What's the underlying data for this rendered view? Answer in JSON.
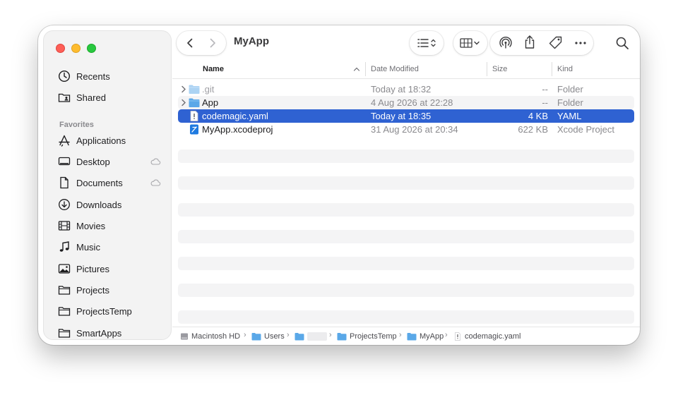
{
  "window": {
    "title": "MyApp"
  },
  "colors": {
    "selection": "#2f62d2",
    "folder": "#5aa8e8",
    "traffic_red": "#fe5f57",
    "traffic_yellow": "#febc2e",
    "traffic_green": "#28c840"
  },
  "sidebar": {
    "items_top": [
      {
        "label": "Recents",
        "icon": "clock-icon"
      },
      {
        "label": "Shared",
        "icon": "shared-folder-icon"
      }
    ],
    "favorites_heading": "Favorites",
    "favorites": [
      {
        "label": "Applications",
        "icon": "applications-icon"
      },
      {
        "label": "Desktop",
        "icon": "desktop-icon",
        "icloud": true
      },
      {
        "label": "Documents",
        "icon": "document-icon",
        "icloud": true
      },
      {
        "label": "Downloads",
        "icon": "download-icon"
      },
      {
        "label": "Movies",
        "icon": "film-icon"
      },
      {
        "label": "Music",
        "icon": "music-note-icon"
      },
      {
        "label": "Pictures",
        "icon": "photo-icon"
      },
      {
        "label": "Projects",
        "icon": "folder-icon"
      },
      {
        "label": "ProjectsTemp",
        "icon": "folder-icon"
      },
      {
        "label": "SmartApps",
        "icon": "folder-icon"
      }
    ]
  },
  "columns": {
    "name": "Name",
    "date": "Date Modified",
    "size": "Size",
    "kind": "Kind"
  },
  "files": [
    {
      "name": ".git",
      "date": "Today at 18:32",
      "size": "--",
      "kind": "Folder",
      "icon": "folder-icon",
      "expandable": true,
      "hidden": true
    },
    {
      "name": "App",
      "date": "4 Aug 2026 at 22:28",
      "size": "--",
      "kind": "Folder",
      "icon": "folder-icon",
      "expandable": true
    },
    {
      "name": "codemagic.yaml",
      "date": "Today at 18:35",
      "size": "4 KB",
      "kind": "YAML",
      "icon": "yaml-file-icon",
      "selected": true
    },
    {
      "name": "MyApp.xcodeproj",
      "date": "31 Aug 2026 at 20:34",
      "size": "622 KB",
      "kind": "Xcode Project",
      "icon": "xcodeproj-icon"
    }
  ],
  "pathbar": [
    "Macintosh HD",
    "Users",
    "",
    "ProjectsTemp",
    "MyApp",
    "codemagic.yaml"
  ]
}
